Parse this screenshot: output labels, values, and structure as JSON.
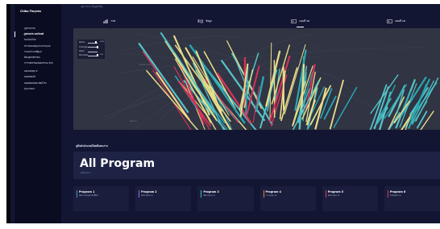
{
  "app": {
    "brand": "Chiba Fluyees"
  },
  "sidebar": {
    "items": [
      {
        "label": "ภูมิภาพร่วม",
        "active": false
      },
      {
        "label": "ภูมิหลังประเทศไทยมี",
        "active": true
      },
      {
        "label": "ของไทยไทย",
        "active": false
      },
      {
        "label": "ทรายพลอยทุนประดาพฤนย",
        "active": false
      },
      {
        "label": "ระนองระบบที่ดูแล",
        "active": false
      },
      {
        "label": "ที่ดนสุหรมิกวิมิ่น",
        "active": false
      },
      {
        "label": "การเกษตรดอยดอยรกนอ จกัย",
        "active": false
      },
      {
        "label": "ออเทอดทุอาย",
        "active": false
      },
      {
        "label": "ยอยอิทอปมื",
        "active": false
      },
      {
        "label": "ยอยอิทเยลิอสะทยิน์โรก",
        "active": false
      },
      {
        "label": "สุพาภรยยา",
        "active": false
      }
    ]
  },
  "header": {
    "subtitle": "ภูมิภาพร่วม ข้อมูลสำคัญ"
  },
  "tabs": [
    {
      "label": "ภาพ",
      "icon": "bar-chart-icon",
      "active": false
    },
    {
      "label": "ข้อมูล",
      "icon": "list-icon",
      "active": false
    },
    {
      "label": "แผนที่ 3D",
      "icon": "map-3d-icon",
      "active": true
    },
    {
      "label": "แผนที่ 2D",
      "icon": "map-2d-icon",
      "active": false
    }
  ],
  "map": {
    "controls": [
      {
        "label": "Radius",
        "value": "1000"
      },
      {
        "label": "Coverage",
        "value": ""
      },
      {
        "label": "Upper",
        "value": ""
      },
      {
        "label": "Percentile",
        "value": "100"
      }
    ],
    "place_labels": [
      "Phitsanulok",
      "Nakhon"
    ],
    "bar_colors": [
      "#e8dd8a",
      "#2aa7b2",
      "#d8325a",
      "#55c3c7"
    ]
  },
  "section": {
    "heading": "ภูมิหลังประเทศไทยมีแผนงาน"
  },
  "all_program": {
    "title": "All Program",
    "subtitle": "ทุกโครงการ"
  },
  "programs": [
    {
      "title": "Program 1",
      "subtitle": "พัฒนาเศรษฐกิจเชิงพื้นที่",
      "color": "#4a8fd8"
    },
    {
      "title": "Program 2",
      "subtitle": "พัฒนาคุณภาพ",
      "color": "#9a6bd8"
    },
    {
      "title": "Program 3",
      "subtitle": "พัฒนาคุณภาพ",
      "color": "#3fb7c2"
    },
    {
      "title": "Program 4",
      "subtitle": "การลงทุนภาพ",
      "color": "#e07a3a"
    },
    {
      "title": "Program 5",
      "subtitle": "พัฒนาคุณภาพ",
      "color": "#d83a5a"
    },
    {
      "title": "Program 6",
      "subtitle": "ปัจจัยคุณภาพ",
      "color": "#d83a5a"
    }
  ]
}
